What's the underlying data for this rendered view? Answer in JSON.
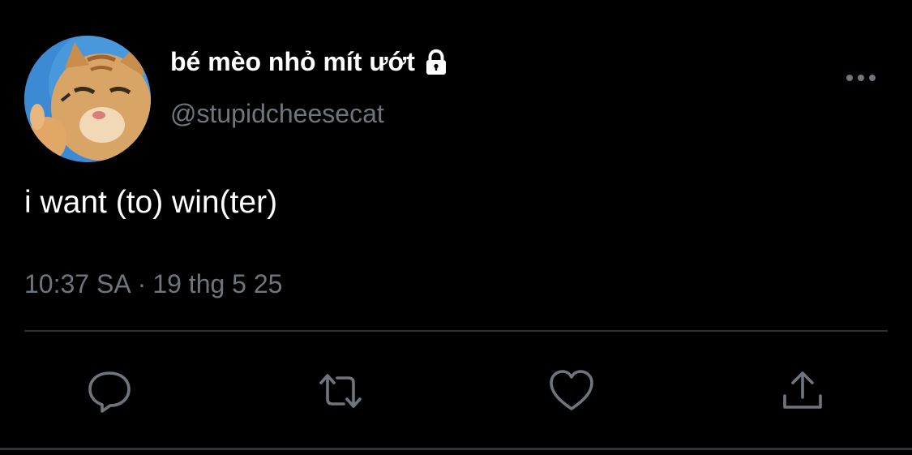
{
  "tweet": {
    "display_name": "bé mèo nhỏ mít ướt",
    "handle": "@stupidcheesecat",
    "text": "i want (to) win(ter)",
    "time": "10:37 SA",
    "separator": "·",
    "date": "19 thg 5 25"
  },
  "icons": {
    "lock": "lock-icon",
    "more": "more-horizontal-icon",
    "reply": "reply-bubble-icon",
    "retweet": "retweet-icon",
    "like": "heart-icon",
    "share": "share-upload-icon"
  },
  "colors": {
    "background": "#000000",
    "primary_text": "#ffffff",
    "secondary_text": "#6e767d",
    "divider": "#2f3336"
  }
}
